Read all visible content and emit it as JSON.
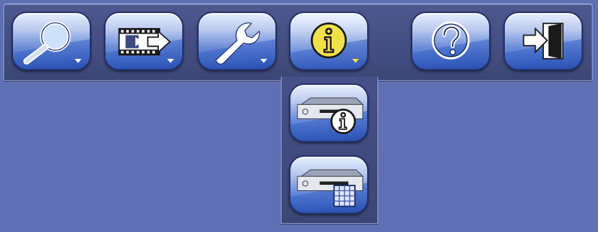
{
  "toolbar": {
    "buttons": [
      {
        "id": "search",
        "icon": "magnifier-icon",
        "has_menu": true
      },
      {
        "id": "video-export",
        "icon": "film-export-icon",
        "has_menu": true
      },
      {
        "id": "settings",
        "icon": "wrench-icon",
        "has_menu": true
      },
      {
        "id": "info",
        "icon": "info-icon",
        "has_menu": true,
        "active": true
      },
      {
        "id": "help",
        "icon": "question-icon",
        "has_menu": false
      },
      {
        "id": "logout",
        "icon": "exit-door-icon",
        "has_menu": false
      }
    ]
  },
  "info_menu": {
    "items": [
      {
        "id": "device-info",
        "icon": "recorder-info-icon"
      },
      {
        "id": "device-log",
        "icon": "recorder-table-icon"
      }
    ]
  },
  "colors": {
    "background": "#5f6fb4",
    "panel": "#3c4676",
    "accent_yellow": "#f2e04a"
  }
}
